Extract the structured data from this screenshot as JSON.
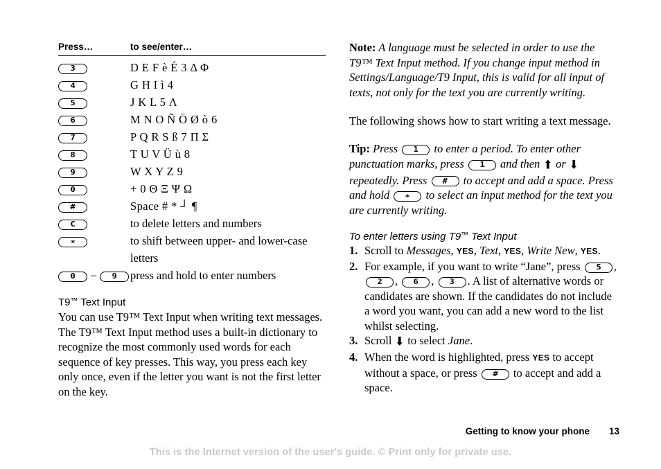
{
  "table": {
    "headers": {
      "col1": "Press…",
      "col2": "to see/enter…"
    },
    "rows": [
      {
        "key": "3",
        "desc": "D E F è É 3 Δ Φ",
        "plain": false
      },
      {
        "key": "4",
        "desc": "G H I ì 4",
        "plain": false
      },
      {
        "key": "5",
        "desc": "J K L 5 Λ",
        "plain": false
      },
      {
        "key": "6",
        "desc": "M N O Ñ Ö Ø ò 6",
        "plain": false
      },
      {
        "key": "7",
        "desc": "P Q R S ß 7 Π Σ",
        "plain": false
      },
      {
        "key": "8",
        "desc": "T U V Ü ù 8",
        "plain": false
      },
      {
        "key": "9",
        "desc": "W X Y Z 9",
        "plain": false
      },
      {
        "key": "0",
        "desc": "+ 0 Θ Ξ Ψ Ω",
        "plain": false
      },
      {
        "key": "#",
        "desc": "Space # * ┘ ¶",
        "plain": false
      },
      {
        "key": "C",
        "desc": "to delete letters and numbers",
        "plain": true
      },
      {
        "key": "∗",
        "desc": "to shift between upper- and lower-case letters",
        "plain": true
      }
    ],
    "range_row": {
      "key_from": "0",
      "key_to": "9",
      "dash": "–",
      "desc": "press and hold to enter numbers"
    }
  },
  "t9_section": {
    "heading_pre": "T9",
    "heading_tm": "™",
    "heading_post": " Text Input",
    "paragraph": "You can use T9™ Text Input when writing text messages. The T9™ Text Input method uses a built-in dictionary to recognize the most commonly used words for each sequence of key presses. This way, you press each key only once, even if the letter you want is not the first letter on the key."
  },
  "note": {
    "label": "Note:",
    "text": " A language must be selected in order to use the T9™ Text Input method. If you change input method in Settings/Language/T9 Input, this is valid for all input of texts, not only for the text you are currently writing."
  },
  "intro": {
    "text": "The following shows how to start writing a text message."
  },
  "tip": {
    "label": "Tip:",
    "part1": " Press ",
    "key1": "1",
    "part2": " to enter a period. To enter other punctuation marks, press ",
    "key2": "1",
    "part3": " and then ",
    "arrow_up": "⬆",
    "part4": " or ",
    "arrow_down": "⬇",
    "part5": " repeatedly. Press ",
    "key3": "#",
    "part6": " to accept and add a space. Press and hold ",
    "key4": "∗",
    "part7": " to select an input method for the text you are currently writing."
  },
  "steps_section": {
    "heading_pre": "To enter letters using T9",
    "heading_tm": "™",
    "heading_post": " Text Input",
    "step1": {
      "pre": "Scroll to ",
      "item1": "Messages",
      "sep1": ", ",
      "yes1": "YES",
      "sep2": ", ",
      "item2": "Text",
      "sep3": ", ",
      "yes2": "YES",
      "sep4": ", ",
      "item3": "Write New",
      "sep5": ", ",
      "yes3": "YES",
      "end": "."
    },
    "step2": {
      "pre": "For example, if you want to write “Jane”, press ",
      "keys": [
        "5",
        "2",
        "6",
        "3"
      ],
      "post": ". A list of alternative words or candidates are shown. If the candidates do not include a word you want, you can add a new word to the list whilst selecting."
    },
    "step3": {
      "pre": "Scroll ",
      "arrow_down": "⬇",
      "mid": " to select ",
      "item": "Jane",
      "end": "."
    },
    "step4": {
      "pre": "When the word is highlighted, press ",
      "yes": "YES",
      "mid": " to accept without a space, or press ",
      "key": "#",
      "post": " to accept and add a space."
    }
  },
  "footer": {
    "chapter": "Getting to know your phone",
    "page_number": "13",
    "internet_notice": "This is the Internet version of the user's guide. © Print only for private use."
  }
}
